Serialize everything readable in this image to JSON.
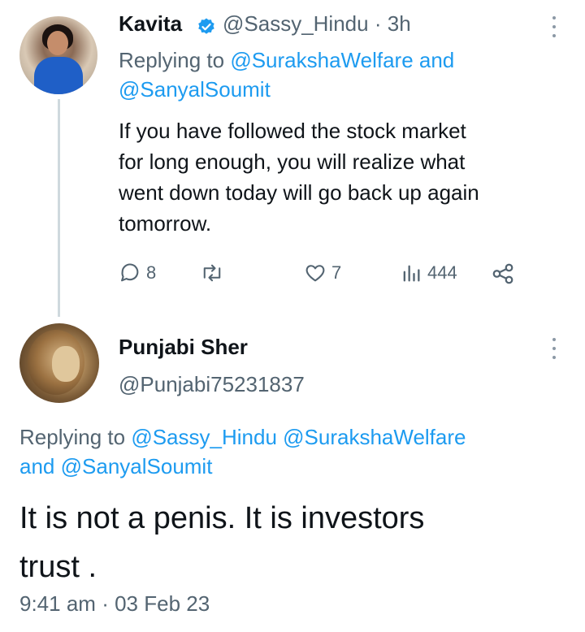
{
  "tweet1": {
    "name": "Kavita",
    "handle": "@Sassy_Hindu",
    "separator": "·",
    "time": "3h",
    "replying_prefix": "Replying to",
    "replying_mention1": "@SurakshaWelfare",
    "replying_and": "and",
    "replying_mention2": "@SanyalSoumit",
    "text": "If you have followed the stock market\nfor long enough, you will realize what\nwent down today will go back up again\ntomorrow.",
    "replies": "8",
    "likes": "7",
    "views": "444"
  },
  "tweet2": {
    "name": "Punjabi Sher",
    "handle": "@Punjabi75231837",
    "replying_prefix": "Replying to",
    "replying_mention1": "@Sassy_Hindu",
    "replying_mention2": "@SurakshaWelfare",
    "replying_and": "and",
    "replying_mention3": "@SanyalSoumit",
    "text": "It is not a penis. It is investors\ntrust .",
    "time": "9:41 am",
    "separator": "·",
    "date": "03 Feb 23"
  },
  "colors": {
    "accent": "#1d9bf0",
    "muted": "#536471",
    "verified": "#1d9bf0"
  }
}
